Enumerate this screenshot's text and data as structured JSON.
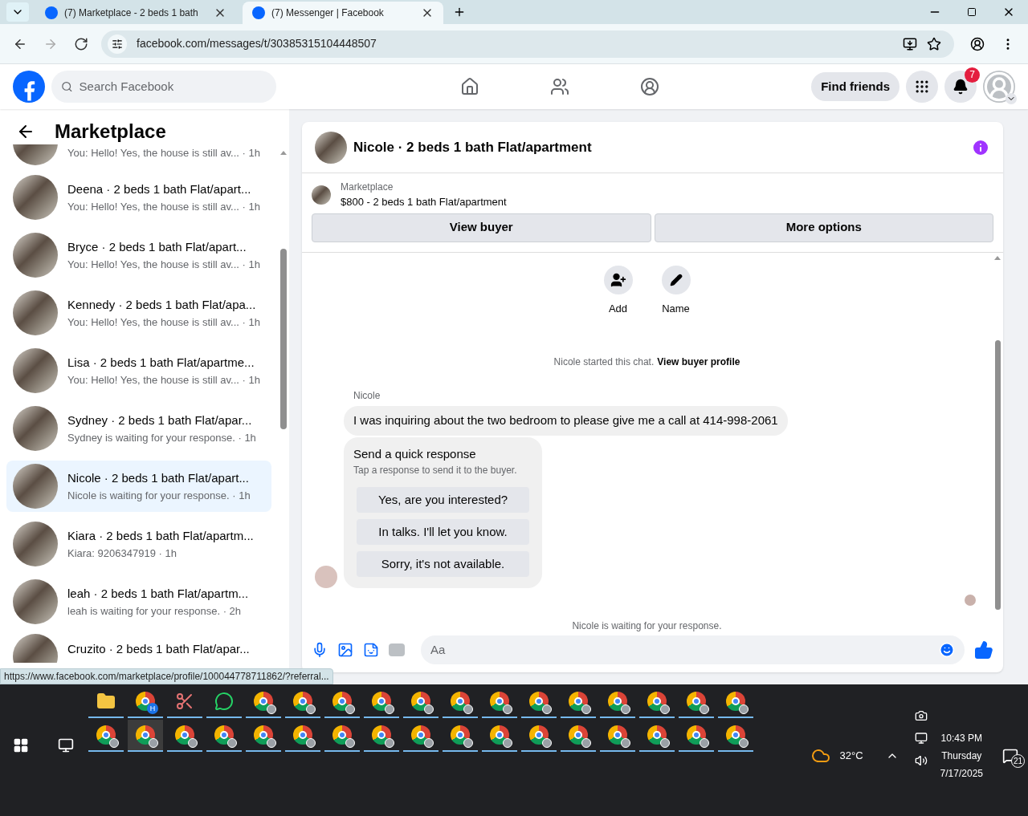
{
  "browser": {
    "tabs": [
      {
        "title": "(7) Marketplace - 2 beds 1 bath",
        "selected": false
      },
      {
        "title": "(7) Messenger | Facebook",
        "selected": true
      }
    ],
    "url": "facebook.com/messages/t/30385315104448507",
    "status_url": "https://www.facebook.com/marketplace/profile/100044778711862/?referral..."
  },
  "header": {
    "search_placeholder": "Search Facebook",
    "find_friends": "Find friends",
    "notification_count": "7"
  },
  "sidebar": {
    "title": "Marketplace",
    "chats": [
      {
        "preview": "You: Hello! Yes, the house is still av...",
        "meta": "· 1h"
      },
      {
        "title": "Deena · 2 beds 1 bath Flat/apart...",
        "preview": "You: Hello! Yes, the house is still av...",
        "meta": "· 1h",
        "selected": false
      },
      {
        "title": "Bryce · 2 beds 1 bath Flat/apart...",
        "preview": "You: Hello! Yes, the house is still av...",
        "meta": "· 1h",
        "selected": false
      },
      {
        "title": "Kennedy · 2 beds 1 bath Flat/apa...",
        "preview": "You: Hello! Yes, the house is still av...",
        "meta": "· 1h",
        "selected": false
      },
      {
        "title": "Lisa · 2 beds 1 bath Flat/apartme...",
        "preview": "You: Hello! Yes, the house is still av...",
        "meta": "· 1h",
        "selected": false
      },
      {
        "title": "Sydney · 2 beds 1 bath Flat/apar...",
        "preview": "Sydney is waiting for your response.",
        "meta": "· 1h",
        "selected": false
      },
      {
        "title": "Nicole · 2 beds 1 bath Flat/apart...",
        "preview": "Nicole is waiting for your response.",
        "meta": "· 1h",
        "selected": true
      },
      {
        "title": "Kiara · 2 beds 1 bath Flat/apartm...",
        "preview": "Kiara: 9206347919",
        "meta": "· 1h",
        "selected": false
      },
      {
        "title": "leah · 2 beds 1 bath Flat/apartm...",
        "preview": "leah is waiting for your response.",
        "meta": "· 2h",
        "selected": false
      },
      {
        "title": "Cruzito · 2 beds 1 bath Flat/apar..."
      }
    ]
  },
  "conversation": {
    "title": "Nicole · 2 beds 1 bath Flat/apartment",
    "listing": {
      "source": "Marketplace",
      "description": "$800 - 2 beds 1 bath Flat/apartment"
    },
    "buttons": [
      "View buyer",
      "More options"
    ],
    "actions": [
      {
        "kind": "add",
        "label": "Add"
      },
      {
        "kind": "name",
        "label": "Name"
      }
    ],
    "started_note": "Nicole started this chat.",
    "started_link": "View buyer profile",
    "sender": "Nicole",
    "message": "I was inquiring about the two bedroom to please give me a call at 414-998-2061",
    "quick": {
      "title": "Send a quick response",
      "subtitle": "Tap a response to send it to the buyer.",
      "options": [
        "Yes, are you interested?",
        "In talks. I'll let you know.",
        "Sorry, it's not available."
      ]
    },
    "waiting_note": "Nicole is waiting for your response.",
    "composer_placeholder": "Aa"
  },
  "taskbar": {
    "rows": [
      [
        {
          "kind": "folder",
          "selected": false
        },
        {
          "kind": "chrome",
          "badge": "H",
          "selected": false
        },
        {
          "kind": "snip",
          "selected": false
        },
        {
          "kind": "whatsapp",
          "selected": false
        },
        {
          "kind": "chrome",
          "selected": false
        },
        {
          "kind": "chrome",
          "selected": false
        },
        {
          "kind": "chrome",
          "selected": false
        },
        {
          "kind": "chrome",
          "selected": false
        },
        {
          "kind": "chrome",
          "selected": false
        },
        {
          "kind": "chrome",
          "selected": false
        },
        {
          "kind": "chrome",
          "selected": false
        },
        {
          "kind": "chrome",
          "selected": false
        },
        {
          "kind": "chrome",
          "selected": false
        },
        {
          "kind": "chrome",
          "selected": false
        },
        {
          "kind": "chrome",
          "selected": false
        },
        {
          "kind": "chrome",
          "selected": false
        },
        {
          "kind": "chrome",
          "selected": false
        }
      ],
      [
        {
          "kind": "chrome",
          "selected": false
        },
        {
          "kind": "chrome",
          "selected": true
        },
        {
          "kind": "chrome",
          "selected": false
        },
        {
          "kind": "chrome",
          "selected": false
        },
        {
          "kind": "chrome",
          "selected": false
        },
        {
          "kind": "chrome",
          "selected": false
        },
        {
          "kind": "chrome",
          "selected": false
        },
        {
          "kind": "chrome",
          "selected": false
        },
        {
          "kind": "chrome",
          "selected": false
        },
        {
          "kind": "chrome",
          "selected": false
        },
        {
          "kind": "chrome",
          "selected": false
        },
        {
          "kind": "chrome",
          "selected": false
        },
        {
          "kind": "chrome",
          "selected": false
        },
        {
          "kind": "chrome",
          "selected": false
        },
        {
          "kind": "chrome",
          "selected": false
        },
        {
          "kind": "chrome",
          "selected": false
        },
        {
          "kind": "chrome",
          "selected": false
        }
      ]
    ],
    "temperature": "32°C",
    "time": "10:43 PM",
    "day": "Thursday",
    "date": "7/17/2025",
    "notification_count": "21"
  }
}
